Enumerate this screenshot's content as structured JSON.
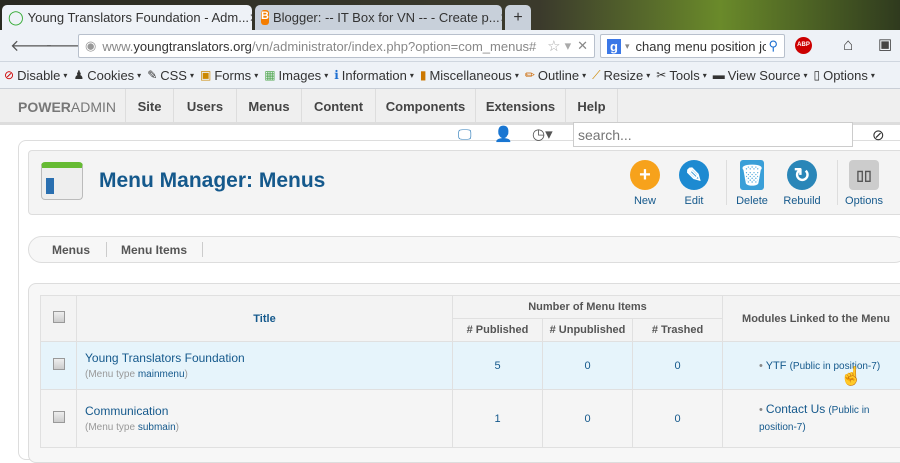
{
  "browser": {
    "tabs": [
      {
        "title": "Young Translators Foundation - Adm...",
        "active": true
      },
      {
        "title": "Blogger: -- IT Box for VN -- - Create p..."
      }
    ],
    "new_tab": "+",
    "url_prefix": "www.",
    "url_domain": "youngtranslators.org",
    "url_path": "/vn/administrator/index.php?option=com_menus#",
    "search_value": "chang menu position jc",
    "abp": "ABP"
  },
  "webdev_toolbar": [
    {
      "label": "Disable",
      "icon": "⊘"
    },
    {
      "label": "Cookies",
      "icon": "♟"
    },
    {
      "label": "CSS",
      "icon": "✎"
    },
    {
      "label": "Forms",
      "icon": "▣"
    },
    {
      "label": "Images",
      "icon": "▦"
    },
    {
      "label": "Information",
      "icon": "ℹ"
    },
    {
      "label": "Miscellaneous",
      "icon": "▮"
    },
    {
      "label": "Outline",
      "icon": "✏"
    },
    {
      "label": "Resize",
      "icon": "⟋"
    },
    {
      "label": "Tools",
      "icon": "✂"
    },
    {
      "label": "View Source",
      "icon": "▬"
    },
    {
      "label": "Options",
      "icon": "▯"
    }
  ],
  "admin": {
    "logo_a": "POWER",
    "logo_b": "ADMIN",
    "menu": [
      "Site",
      "Users",
      "Menus",
      "Content",
      "Components",
      "Extensions",
      "Help"
    ],
    "search_placeholder": "search..."
  },
  "page": {
    "title": "Menu Manager: Menus",
    "toolbar": [
      {
        "label": "New",
        "icon": "plus-icon",
        "color": "#f7a21b"
      },
      {
        "label": "Edit",
        "icon": "pencil-icon",
        "color": "#1d8ad1"
      },
      {
        "label": "Delete",
        "icon": "trash-icon",
        "color": "#3a9fd8"
      },
      {
        "label": "Rebuild",
        "icon": "refresh-icon",
        "color": "#2a86b8"
      },
      {
        "label": "Options",
        "icon": "options-icon",
        "color": "#999999"
      }
    ],
    "subnav": [
      "Menus",
      "Menu Items"
    ]
  },
  "table": {
    "headers": {
      "title": "Title",
      "group": "Number of Menu Items",
      "published": "# Published",
      "unpublished": "# Unpublished",
      "trashed": "# Trashed",
      "modules": "Modules Linked to the Menu"
    },
    "rows": [
      {
        "title": "Young Translators Foundation",
        "type_label": "Menu type",
        "type": "mainmenu",
        "published": "5",
        "unpublished": "0",
        "trashed": "0",
        "module": "YTF",
        "module_info": "(Public in position-7)"
      },
      {
        "title": "Communication",
        "type_label": "Menu type",
        "type": "submain",
        "published": "1",
        "unpublished": "0",
        "trashed": "0",
        "module": "Contact Us",
        "module_info": "(Public in position-7)"
      }
    ]
  }
}
